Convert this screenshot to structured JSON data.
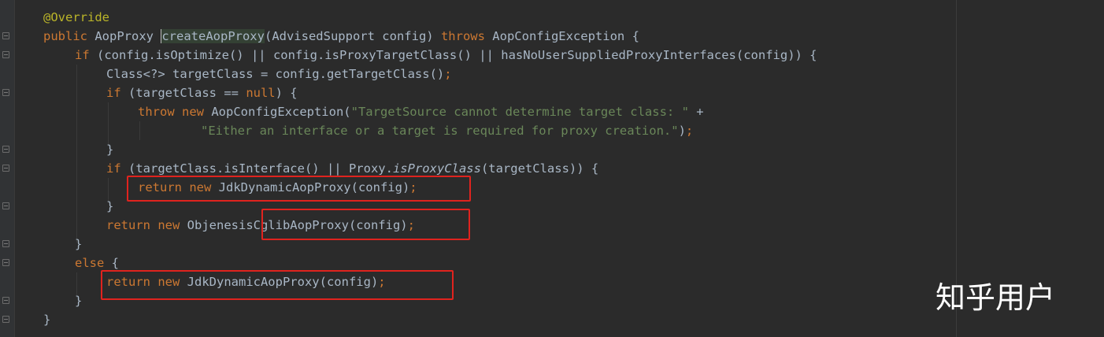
{
  "colors": {
    "background": "#2b2b2b",
    "keyword": "#cc7832",
    "annotation": "#bbb529",
    "string": "#6a8759",
    "text": "#a9b7c6",
    "highlight_box": "#e0231e"
  },
  "code": {
    "l1": {
      "annotation": "@Override"
    },
    "l2": {
      "kw1": "public",
      "t1": " AopProxy ",
      "method": "createAopProxy",
      "t2": "(AdvisedSupport config) ",
      "kw2": "throws",
      "t3": " AopConfigException {"
    },
    "l3": {
      "kw1": "if",
      "t1": " (config.isOptimize() || config.isProxyTargetClass() || hasNoUserSuppliedProxyInterfaces(config)) {"
    },
    "l4": {
      "t1": "Class<?> targetClass = config.getTargetClass()",
      "semi": ";"
    },
    "l5": {
      "kw1": "if",
      "t1": " (targetClass == ",
      "kw2": "null",
      "t2": ") {"
    },
    "l6": {
      "kw1": "throw new",
      "t1": " AopConfigException(",
      "str": "\"TargetSource cannot determine target class: \"",
      "t2": " +"
    },
    "l7": {
      "str": "\"Either an interface or a target is required for proxy creation.\"",
      "t1": ")",
      "semi": ";"
    },
    "l8": {
      "t1": "}"
    },
    "l9": {
      "kw1": "if",
      "t1": " (targetClass.isInterface() || Proxy.",
      "italic": "isProxyClass",
      "t2": "(targetClass)) {"
    },
    "l10": {
      "kw1": "return new",
      "t1": " JdkDynamicAopProxy(config)",
      "semi": ";"
    },
    "l11": {
      "t1": "}"
    },
    "l12": {
      "kw1": "return new",
      "t1": " ObjenesisCglibAopProxy(config)",
      "semi": ";"
    },
    "l13": {
      "t1": "}"
    },
    "l14": {
      "kw1": "else",
      "t1": " {"
    },
    "l15": {
      "kw1": "return new",
      "t1": " JdkDynamicAopProxy(config)",
      "semi": ";"
    },
    "l16": {
      "t1": "}"
    },
    "l17": {
      "t1": "}"
    }
  },
  "watermark": "知乎用户"
}
